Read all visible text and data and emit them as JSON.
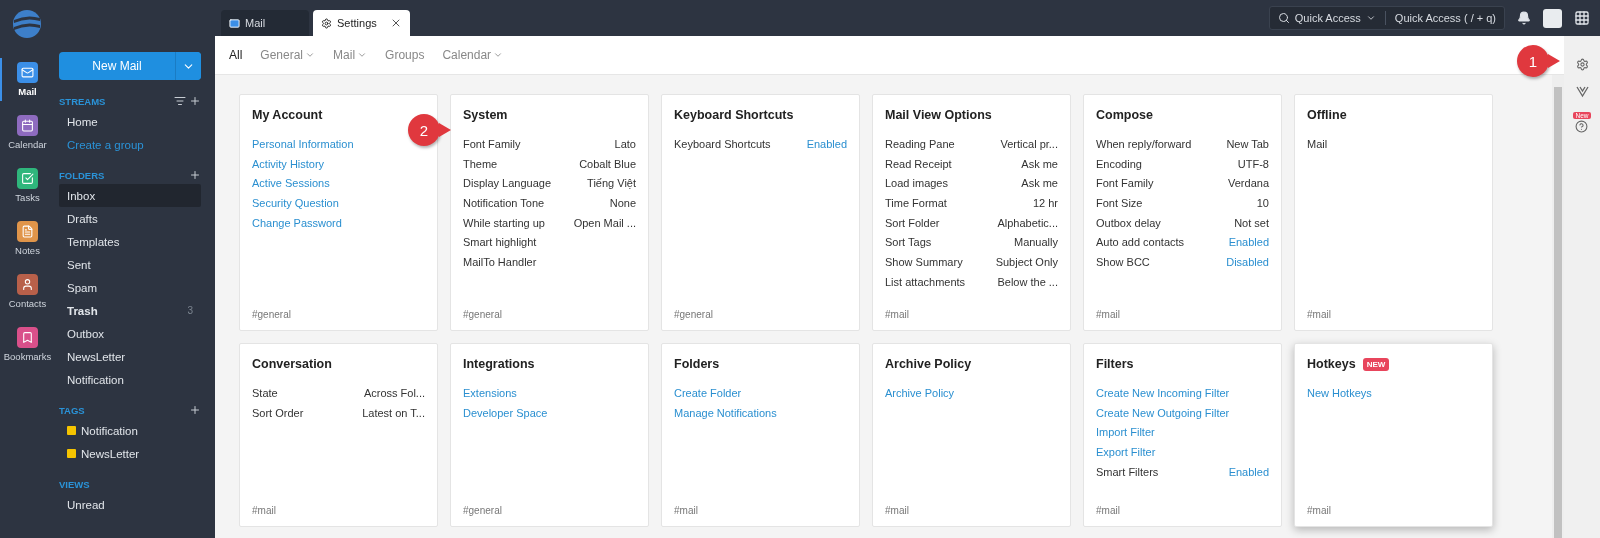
{
  "apps": [
    {
      "label": "Mail",
      "color": "#3b8fe8",
      "selected": true
    },
    {
      "label": "Calendar",
      "color": "#8e6bbf",
      "selected": false
    },
    {
      "label": "Tasks",
      "color": "#2fb67c",
      "selected": false
    },
    {
      "label": "Notes",
      "color": "#e0954a",
      "selected": false
    },
    {
      "label": "Contacts",
      "color": "#b8604a",
      "selected": false
    },
    {
      "label": "Bookmarks",
      "color": "#d9508a",
      "selected": false
    }
  ],
  "new_mail": "New Mail",
  "streams": {
    "title": "STREAMS",
    "items": [
      {
        "label": "Home",
        "kind": "item"
      },
      {
        "label": "Create a group",
        "kind": "link"
      }
    ]
  },
  "folders": {
    "title": "FOLDERS",
    "items": [
      {
        "label": "Inbox",
        "selected": true,
        "unread": false
      },
      {
        "label": "Drafts",
        "selected": false,
        "unread": false
      },
      {
        "label": "Templates",
        "selected": false,
        "unread": false
      },
      {
        "label": "Sent",
        "selected": false,
        "unread": false
      },
      {
        "label": "Spam",
        "selected": false,
        "unread": false
      },
      {
        "label": "Trash",
        "selected": false,
        "unread": true,
        "count": "3"
      },
      {
        "label": "Outbox",
        "selected": false,
        "unread": false
      },
      {
        "label": "NewsLetter",
        "selected": false,
        "unread": false
      },
      {
        "label": "Notification",
        "selected": false,
        "unread": false
      }
    ]
  },
  "tags": {
    "title": "TAGS",
    "items": [
      {
        "label": "Notification",
        "color": "#f5c400"
      },
      {
        "label": "NewsLetter",
        "color": "#f5c400"
      }
    ]
  },
  "views": {
    "title": "VIEWS",
    "items": [
      {
        "label": "Unread"
      }
    ]
  },
  "tabs": [
    {
      "label": "Mail",
      "selected": false,
      "closable": false
    },
    {
      "label": "Settings",
      "selected": true,
      "closable": true
    }
  ],
  "quick_access": {
    "label": "Quick Access",
    "hint": "Quick Access ( / + q)"
  },
  "settings_nav": [
    {
      "label": "All",
      "selected": true,
      "dropdown": false
    },
    {
      "label": "General",
      "selected": false,
      "dropdown": true
    },
    {
      "label": "Mail",
      "selected": false,
      "dropdown": true
    },
    {
      "label": "Groups",
      "selected": false,
      "dropdown": false
    },
    {
      "label": "Calendar",
      "selected": false,
      "dropdown": true
    }
  ],
  "side_badge": "New",
  "callouts": [
    {
      "number": "1"
    },
    {
      "number": "2"
    }
  ],
  "cards": [
    {
      "title": "My Account",
      "tag": "#general",
      "items": [
        {
          "kind": "link",
          "label": "Personal Information"
        },
        {
          "kind": "link",
          "label": "Activity History"
        },
        {
          "kind": "link",
          "label": "Active Sessions"
        },
        {
          "kind": "link",
          "label": "Security Question"
        },
        {
          "kind": "link",
          "label": "Change Password"
        }
      ]
    },
    {
      "title": "System",
      "tag": "#general",
      "items": [
        {
          "kind": "setting",
          "label": "Font Family",
          "value": "Lato",
          "value_link": false
        },
        {
          "kind": "setting",
          "label": "Theme",
          "value": "Cobalt Blue",
          "value_link": false
        },
        {
          "kind": "setting",
          "label": "Display Language",
          "value": "Tiếng Việt",
          "value_link": false
        },
        {
          "kind": "setting",
          "label": "Notification Tone",
          "value": "None",
          "value_link": false
        },
        {
          "kind": "setting",
          "label": "While starting up",
          "value": "Open Mail ...",
          "value_link": false
        },
        {
          "kind": "setting",
          "label": "Smart highlight"
        },
        {
          "kind": "setting",
          "label": "MailTo Handler"
        }
      ]
    },
    {
      "title": "Keyboard Shortcuts",
      "tag": "#general",
      "items": [
        {
          "kind": "setting",
          "label": "Keyboard Shortcuts",
          "value": "Enabled",
          "value_link": true
        }
      ]
    },
    {
      "title": "Mail View Options",
      "tag": "#mail",
      "items": [
        {
          "kind": "setting",
          "label": "Reading Pane",
          "value": "Vertical pr...",
          "value_link": false
        },
        {
          "kind": "setting",
          "label": "Read Receipt",
          "value": "Ask me",
          "value_link": false
        },
        {
          "kind": "setting",
          "label": "Load images",
          "value": "Ask me",
          "value_link": false
        },
        {
          "kind": "setting",
          "label": "Time Format",
          "value": "12 hr",
          "value_link": false
        },
        {
          "kind": "setting",
          "label": "Sort Folder",
          "value": "Alphabetic...",
          "value_link": false
        },
        {
          "kind": "setting",
          "label": "Sort Tags",
          "value": "Manually",
          "value_link": false
        },
        {
          "kind": "setting",
          "label": "Show Summary",
          "value": "Subject Only",
          "value_link": false
        },
        {
          "kind": "setting",
          "label": "List attachments",
          "value": "Below the ...",
          "value_link": false
        }
      ]
    },
    {
      "title": "Compose",
      "tag": "#mail",
      "items": [
        {
          "kind": "setting",
          "label": "When reply/forward",
          "value": "New Tab",
          "value_link": false
        },
        {
          "kind": "setting",
          "label": "Encoding",
          "value": "UTF-8",
          "value_link": false
        },
        {
          "kind": "setting",
          "label": "Font Family",
          "value": "Verdana",
          "value_link": false
        },
        {
          "kind": "setting",
          "label": "Font Size",
          "value": "10",
          "value_link": false
        },
        {
          "kind": "setting",
          "label": "Outbox delay",
          "value": "Not set",
          "value_link": false
        },
        {
          "kind": "setting",
          "label": "Auto add contacts",
          "value": "Enabled",
          "value_link": true
        },
        {
          "kind": "setting",
          "label": "Show BCC",
          "value": "Disabled",
          "value_link": true
        }
      ]
    },
    {
      "title": "Offline",
      "tag": "#mail",
      "items": [
        {
          "kind": "setting",
          "label": "Mail"
        }
      ]
    },
    {
      "title": "Conversation",
      "tag": "#mail",
      "items": [
        {
          "kind": "setting",
          "label": "State",
          "value": "Across Fol...",
          "value_link": false
        },
        {
          "kind": "setting",
          "label": "Sort Order",
          "value": "Latest on T...",
          "value_link": false
        }
      ]
    },
    {
      "title": "Integrations",
      "tag": "#general",
      "items": [
        {
          "kind": "link",
          "label": "Extensions"
        },
        {
          "kind": "link",
          "label": "Developer Space"
        }
      ]
    },
    {
      "title": "Folders",
      "tag": "#mail",
      "items": [
        {
          "kind": "link",
          "label": "Create Folder"
        },
        {
          "kind": "link",
          "label": "Manage Notifications"
        }
      ]
    },
    {
      "title": "Archive Policy",
      "tag": "#mail",
      "items": [
        {
          "kind": "link",
          "label": "Archive Policy"
        }
      ]
    },
    {
      "title": "Filters",
      "tag": "#mail",
      "items": [
        {
          "kind": "link",
          "label": "Create New Incoming Filter"
        },
        {
          "kind": "link",
          "label": "Create New Outgoing Filter"
        },
        {
          "kind": "link",
          "label": "Import Filter"
        },
        {
          "kind": "link",
          "label": "Export Filter"
        },
        {
          "kind": "setting",
          "label": "Smart Filters",
          "value": "Enabled",
          "value_link": true
        }
      ]
    },
    {
      "title": "Hotkeys",
      "tag": "#mail",
      "badge": "NEW",
      "raised": true,
      "items": [
        {
          "kind": "link",
          "label": "New Hotkeys"
        }
      ]
    }
  ]
}
